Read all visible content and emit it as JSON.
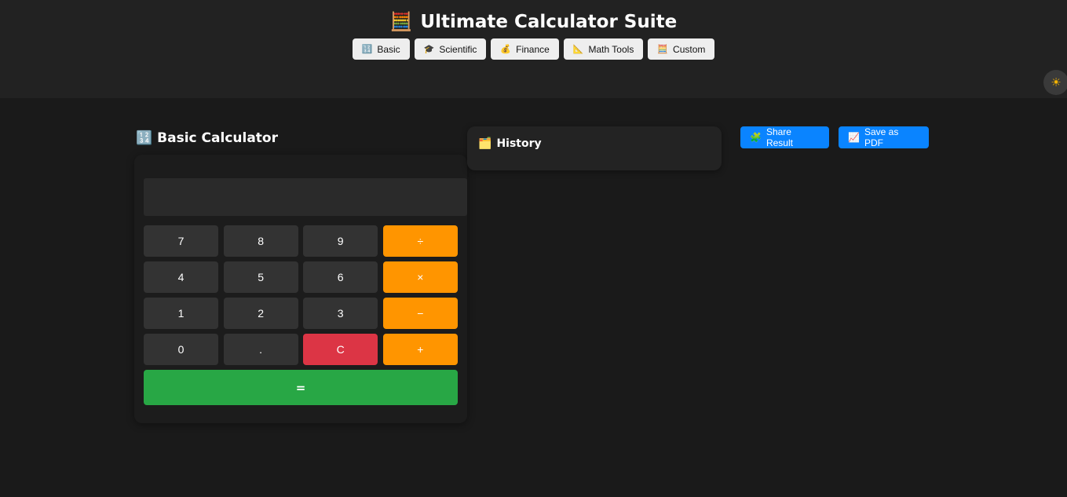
{
  "header": {
    "title": "Ultimate Calculator Suite",
    "title_icon": "🧮",
    "tabs": [
      {
        "icon": "🔢",
        "label": "Basic"
      },
      {
        "icon": "🎓",
        "label": "Scientific"
      },
      {
        "icon": "💰",
        "label": "Finance"
      },
      {
        "icon": "📐",
        "label": "Math Tools"
      },
      {
        "icon": "🧮",
        "label": "Custom"
      }
    ],
    "theme_icon": "☀"
  },
  "calculator": {
    "title": "Basic Calculator",
    "title_icon": "🔢",
    "display_value": "",
    "keys": [
      "7",
      "8",
      "9",
      "÷",
      "4",
      "5",
      "6",
      "×",
      "1",
      "2",
      "3",
      "−",
      "0",
      ".",
      "C",
      "+"
    ],
    "equals_label": "="
  },
  "history": {
    "title": "History",
    "title_icon": "🗂️"
  },
  "actions": {
    "share_icon": "🧩",
    "share_label": "Share Result",
    "pdf_icon": "📈",
    "pdf_label": "Save as PDF"
  },
  "colors": {
    "operator": "#ff9500",
    "clear": "#dc3545",
    "equals": "#28a745",
    "action": "#0a84ff"
  }
}
